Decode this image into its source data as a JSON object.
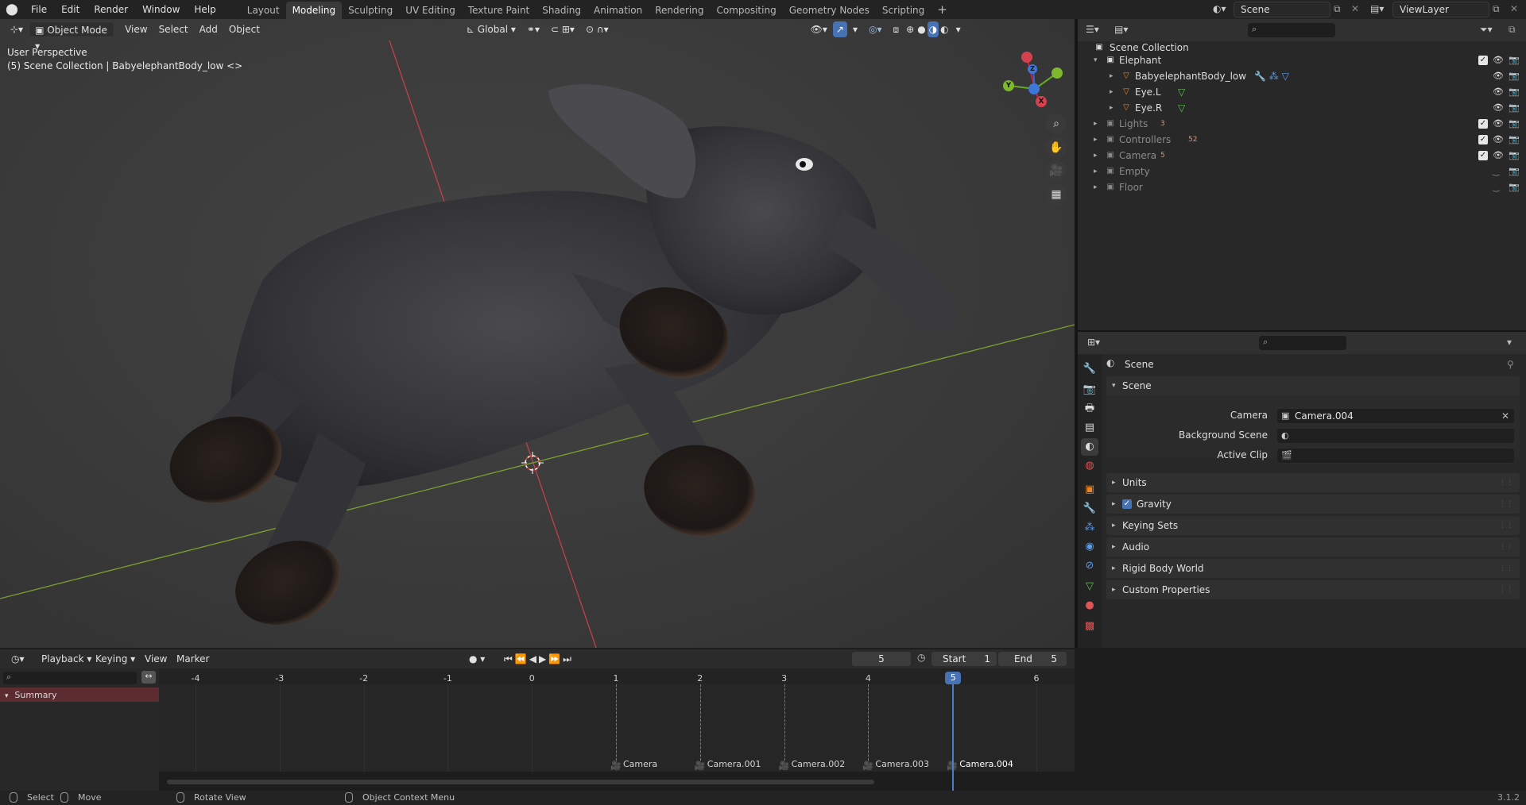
{
  "topbar": {
    "menus": [
      "File",
      "Edit",
      "Render",
      "Window",
      "Help"
    ],
    "workspaces": [
      "Layout",
      "Modeling",
      "Sculpting",
      "UV Editing",
      "Texture Paint",
      "Shading",
      "Animation",
      "Rendering",
      "Compositing",
      "Geometry Nodes",
      "Scripting"
    ],
    "active_workspace": "Modeling",
    "scene": "Scene",
    "view_layer": "ViewLayer"
  },
  "viewport": {
    "mode": "Object Mode",
    "menus": [
      "View",
      "Select",
      "Add",
      "Object"
    ],
    "transform_orientation": "Global",
    "perspective_label": "User Perspective",
    "context_label": "(5) Scene Collection | BabyelephantBody_low <>",
    "gizmo_axes": [
      "X",
      "Y",
      "Z"
    ]
  },
  "outliner": {
    "root": "Scene Collection",
    "rows": [
      {
        "name": "Elephant",
        "type": "collection",
        "dim": false,
        "extra": ""
      },
      {
        "name": "BabyelephantBody_low",
        "type": "mesh",
        "dim": false,
        "extra": ""
      },
      {
        "name": "Eye.L",
        "type": "mesh",
        "dim": false,
        "extra": ""
      },
      {
        "name": "Eye.R",
        "type": "mesh",
        "dim": false,
        "extra": ""
      },
      {
        "name": "Lights",
        "type": "collection",
        "dim": true,
        "extra": "3"
      },
      {
        "name": "Controllers",
        "type": "collection",
        "dim": true,
        "extra": "52"
      },
      {
        "name": "Camera",
        "type": "collection",
        "dim": true,
        "extra": "5"
      },
      {
        "name": "Empty",
        "type": "collection",
        "dim": true,
        "extra": ""
      },
      {
        "name": "Floor",
        "type": "collection",
        "dim": true,
        "extra": ""
      }
    ]
  },
  "properties": {
    "breadcrumb": "Scene",
    "scene_panel": "Scene",
    "fields": [
      {
        "label": "Camera",
        "value": "Camera.004"
      },
      {
        "label": "Background Scene",
        "value": ""
      },
      {
        "label": "Active Clip",
        "value": ""
      }
    ],
    "panels": [
      "Units",
      "Gravity",
      "Keying Sets",
      "Audio",
      "Rigid Body World",
      "Custom Properties"
    ],
    "gravity_checked": true
  },
  "timeline": {
    "menus": [
      "Playback",
      "Keying",
      "View",
      "Marker"
    ],
    "current_frame": "5",
    "start_label": "Start",
    "start": "1",
    "end_label": "End",
    "end": "5",
    "ruler": [
      "-4",
      "-3",
      "-2",
      "-1",
      "0",
      "1",
      "2",
      "3",
      "4",
      "5",
      "6"
    ],
    "summary": "Summary",
    "markers": [
      "Camera",
      "Camera.001",
      "Camera.002",
      "Camera.003",
      "Camera.004"
    ]
  },
  "status": {
    "select": "Select",
    "move": "Move",
    "rotate": "Rotate View",
    "context_menu": "Object Context Menu",
    "version": "3.1.2"
  }
}
